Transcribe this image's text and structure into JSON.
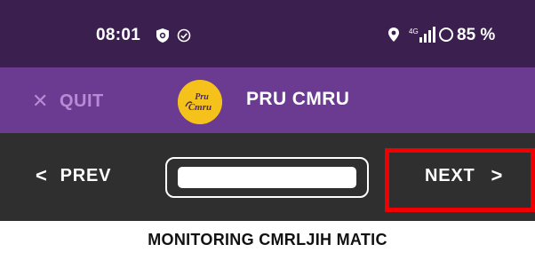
{
  "status_bar": {
    "time": "08:01",
    "battery": "85 %",
    "icons": [
      "shield-icon",
      "check-circle-icon",
      "location-icon",
      "signal-icon",
      "battery-icon"
    ]
  },
  "app_bar": {
    "quit_label": "QUIT",
    "title": "PRU CMRU",
    "logo_text": "Pru Cmru"
  },
  "nav": {
    "prev_label": "PREV",
    "next_label": "NEXT",
    "progress_fraction": 1.0
  },
  "page": {
    "title": "MONITORING CMRLJIH MATIC"
  },
  "colors": {
    "status_bar": "#3b1f4f",
    "app_bar": "#6b3b91",
    "nav_bar": "#2f2f2f",
    "quit_text": "#b88ad6",
    "logo_bg": "#f5c21b",
    "highlight": "#f00000"
  }
}
